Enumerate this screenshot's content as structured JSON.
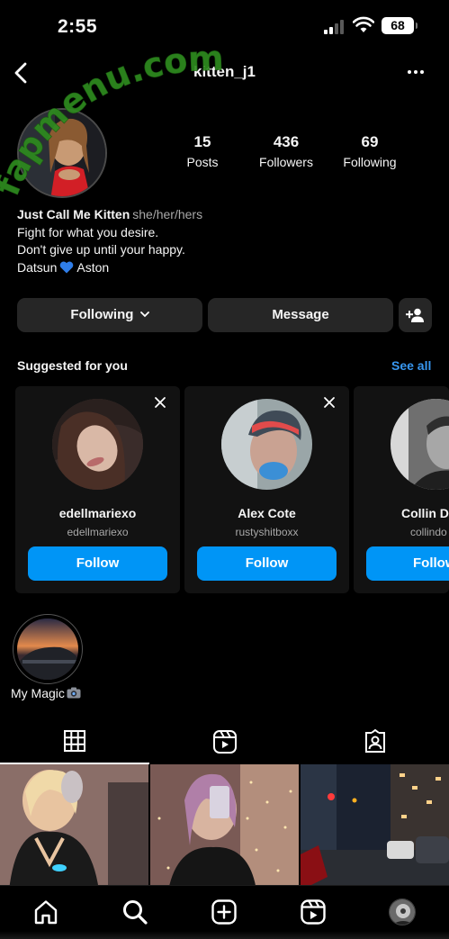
{
  "status_bar": {
    "time": "2:55",
    "battery": "68"
  },
  "header": {
    "username": "kitten_j1",
    "back_icon": "chevron-left-icon",
    "more_icon": "more-horizontal-icon"
  },
  "watermark": "fapmenu.com",
  "profile": {
    "stats": [
      {
        "value": "15",
        "label": "Posts"
      },
      {
        "value": "436",
        "label": "Followers"
      },
      {
        "value": "69",
        "label": "Following"
      }
    ],
    "bio": {
      "name": "Just Call Me Kitten",
      "pronouns": "she/her/hers",
      "line1": "Fight for what you desire.",
      "line2": "Don't give up until your happy.",
      "line3_before": "Datsun",
      "line3_after": "Aston"
    },
    "buttons": {
      "following": "Following",
      "message": "Message"
    }
  },
  "suggestions": {
    "title": "Suggested for you",
    "see_all": "See all",
    "cards": [
      {
        "name": "edellmariexo",
        "handle": "edellmariexo",
        "button": "Follow"
      },
      {
        "name": "Alex Cote",
        "handle": "rustyshitboxx",
        "button": "Follow"
      },
      {
        "name": "Collin D",
        "handle": "collindo",
        "button": "Follow"
      }
    ]
  },
  "highlights": [
    {
      "label": "My Magic"
    }
  ],
  "tabs": [
    "grid-icon",
    "reels-icon",
    "tagged-icon"
  ],
  "nav": [
    "home-icon",
    "search-icon",
    "create-icon",
    "reels-icon",
    "profile-avatar"
  ],
  "colors": {
    "accent": "#0095f6",
    "link": "#3897f0",
    "button_bg": "#262626",
    "watermark": "#2e8b1e"
  }
}
